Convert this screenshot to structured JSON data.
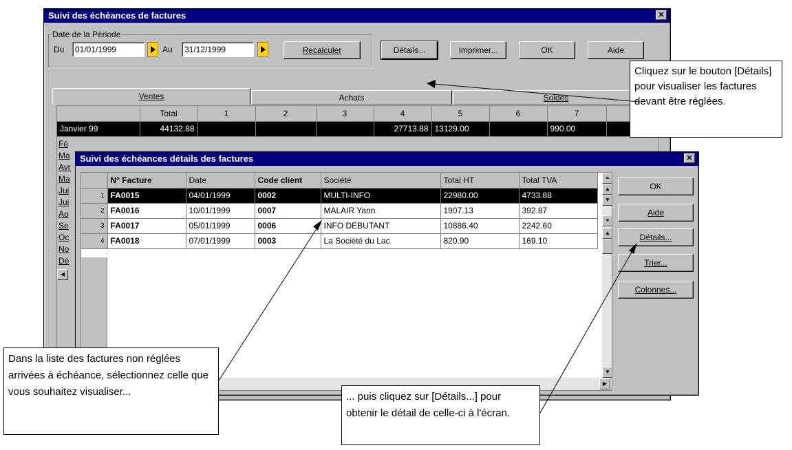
{
  "outer": {
    "title": "Suivi des échéances de factures",
    "period_group": "Date de la Période",
    "du_label": "Du",
    "du_value": "01/01/1999",
    "au_label": "Au",
    "au_value": "31/12/1999",
    "btn_recalculer": "Recalculer",
    "btn_details": "Détails...",
    "btn_imprimer": "Imprimer...",
    "btn_ok": "OK",
    "btn_aide": "Aide",
    "tabs": [
      "Ventes",
      "Achats",
      "Soldes"
    ],
    "columns": [
      "Total",
      "1",
      "2",
      "3",
      "4",
      "5",
      "6",
      "7"
    ],
    "row_jan": {
      "label": "Janvier 99",
      "total": "44132.88",
      "c4": "27713.88",
      "c5": "13129.00",
      "c7": "990.00"
    },
    "months": [
      "Fé",
      "Ma",
      "Avr",
      "Ma",
      "Jui",
      "Jui",
      "Ao",
      "Se",
      "Oc",
      "No",
      "Dé"
    ]
  },
  "inner": {
    "title": "Suivi des échéances détails des factures",
    "headers": [
      "N° Facture",
      "Date",
      "Code client",
      "Société",
      "Total HT",
      "Total TVA"
    ],
    "rows": [
      {
        "n": "1",
        "facture": "FA0015",
        "date": "04/01/1999",
        "code": "0002",
        "societe": "MULTI-INFO",
        "ht": "22980.00",
        "tva": "4733.88"
      },
      {
        "n": "2",
        "facture": "FA0016",
        "date": "10/01/1999",
        "code": "0007",
        "societe": "MALAIR Yann",
        "ht": "1907.13",
        "tva": "392.87"
      },
      {
        "n": "3",
        "facture": "FA0017",
        "date": "05/01/1999",
        "code": "0006",
        "societe": "INFO DEBUTANT",
        "ht": "10886.40",
        "tva": "2242.60"
      },
      {
        "n": "4",
        "facture": "FA0018",
        "date": "07/01/1999",
        "code": "0003",
        "societe": "La Société du Lac",
        "ht": "820.90",
        "tva": "169.10"
      }
    ],
    "btn_ok": "OK",
    "btn_aide": "Aide",
    "btn_details": "Détails...",
    "btn_trier": "Trier...",
    "btn_colonnes": "Colonnes..."
  },
  "callouts": {
    "top_right": "Cliquez sur le bouton [Détails] pour visualiser les factures devant être réglées.",
    "bottom_left": "Dans la liste des factures non réglées arrivées à échéance, sélectionnez celle que vous souhaitez visualiser...",
    "bottom_mid": "... puis cliquez sur [Détails...] pour obtenir le détail de celle-ci à l'écran."
  },
  "colors": {
    "titlebar": "#000080",
    "selected_row": "#000000",
    "arrow_button": "#ffd200"
  }
}
